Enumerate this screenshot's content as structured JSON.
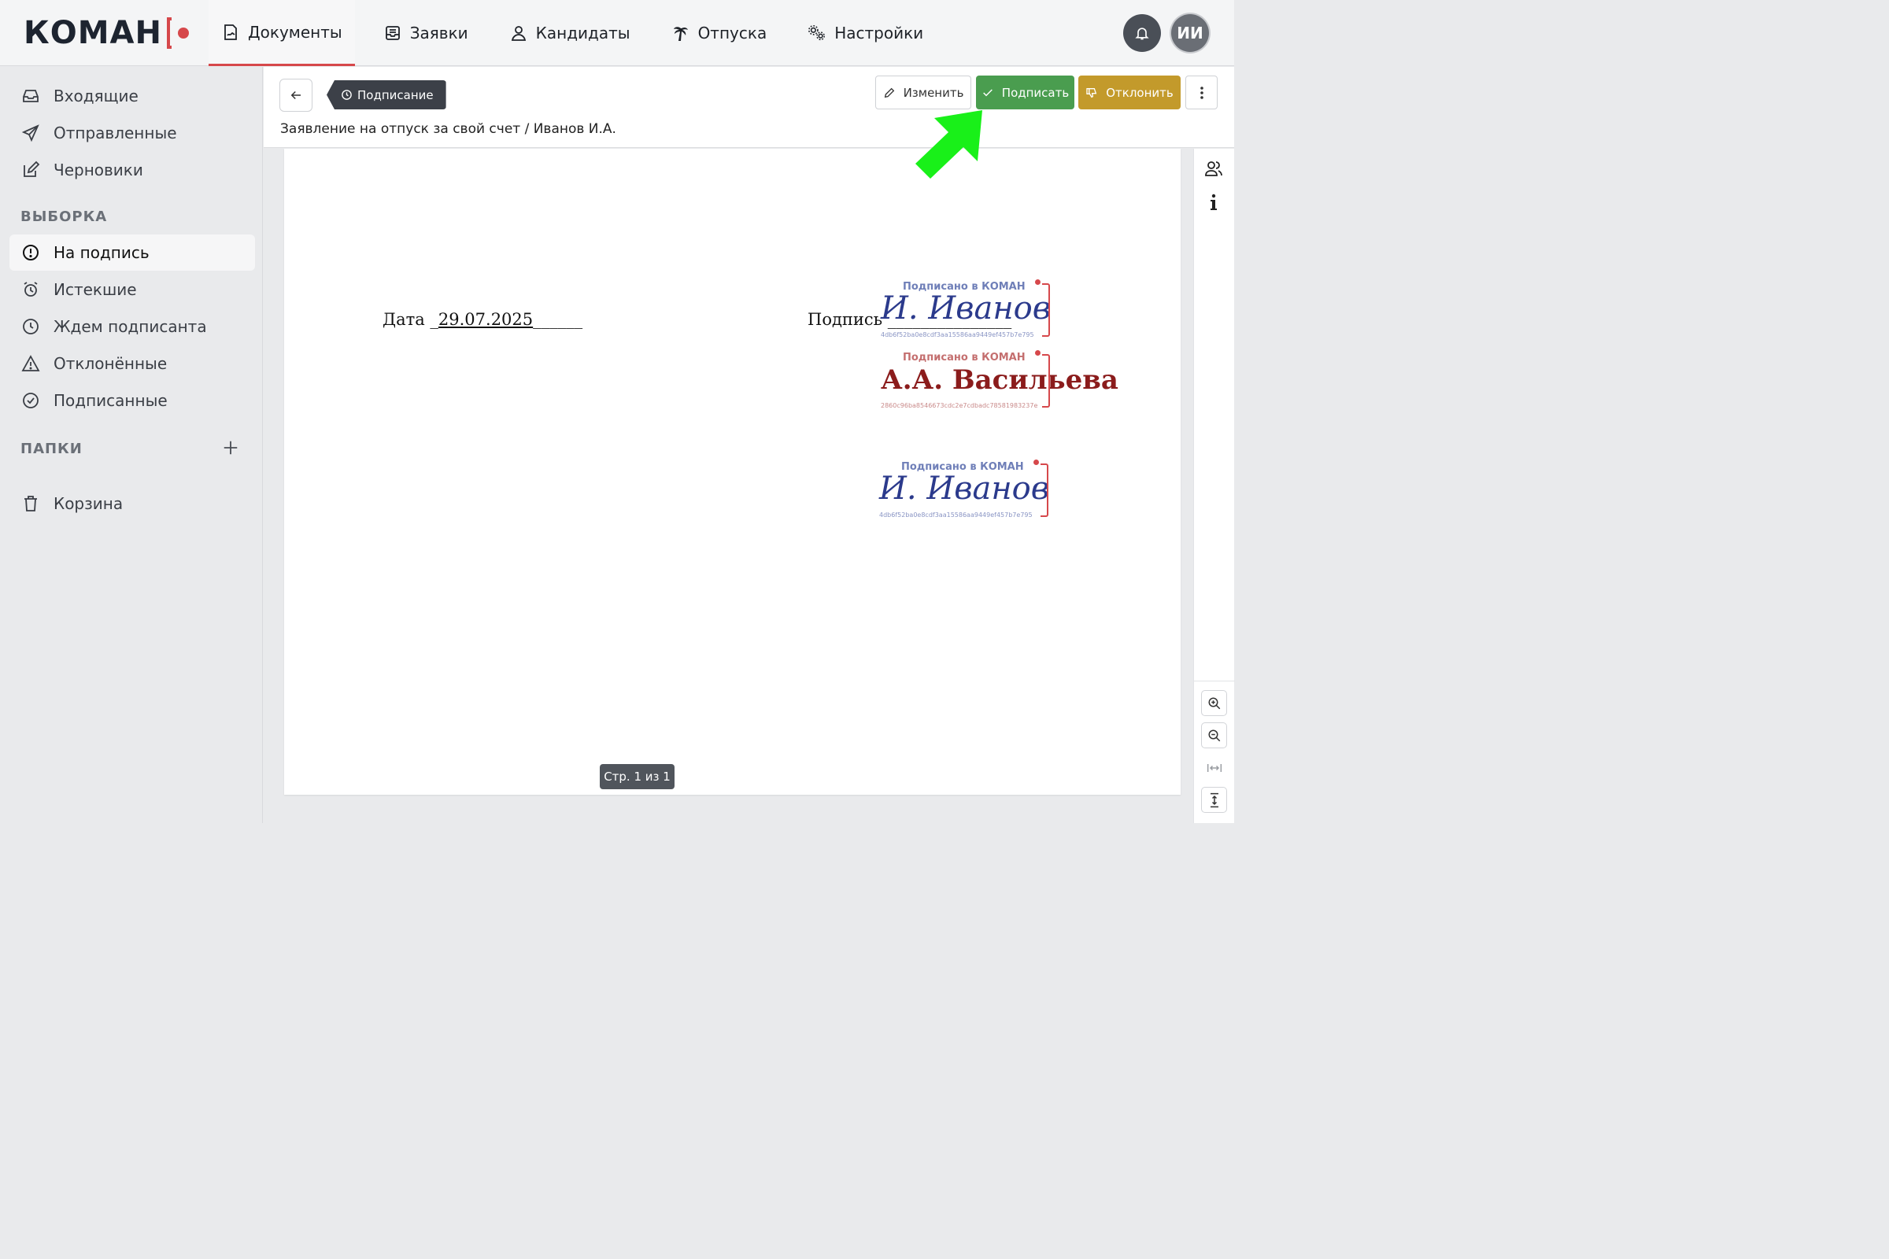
{
  "brand": {
    "name": "КОМАН",
    "accent": "#d6484b"
  },
  "nav": {
    "items": [
      {
        "label": "Документы",
        "icon": "document-signature-icon",
        "active": true
      },
      {
        "label": "Заявки",
        "icon": "inbox-tray-icon"
      },
      {
        "label": "Кандидаты",
        "icon": "candidate-icon"
      },
      {
        "label": "Отпуска",
        "icon": "palm-tree-icon"
      },
      {
        "label": "Настройки",
        "icon": "gears-icon"
      }
    ],
    "avatar_initials": "ИИ"
  },
  "sidebar": {
    "top_items": [
      {
        "label": "Входящие",
        "icon": "inbox-icon"
      },
      {
        "label": "Отправленные",
        "icon": "paper-plane-icon"
      },
      {
        "label": "Черновики",
        "icon": "edit-icon"
      }
    ],
    "section_filter": "ВЫБОРКА",
    "filter_items": [
      {
        "label": "На подпись",
        "icon": "exclamation-circle-icon",
        "active": true
      },
      {
        "label": "Истекшие",
        "icon": "alarm-clock-icon"
      },
      {
        "label": "Ждем подписанта",
        "icon": "clock-icon"
      },
      {
        "label": "Отклонённые",
        "icon": "warning-triangle-icon"
      },
      {
        "label": "Подписанные",
        "icon": "check-circle-icon"
      }
    ],
    "section_folders": "ПАПКИ",
    "trash_label": "Корзина"
  },
  "document": {
    "status": "Подписание",
    "title": "Заявление на отпуск за свой счет / Иванов И.А.",
    "actions": {
      "edit": "Изменить",
      "sign": "Подписать",
      "reject": "Отклонить"
    },
    "date_label": "Дата _",
    "date_value": "29.07.2025",
    "date_tail": "______",
    "sign_label": "Подпись _______________",
    "stamps": [
      {
        "caption": "Подписано в КОМАН",
        "signature": "И. Иванов",
        "hash": "4db6f52ba0e8cdf3aa15586aa9449ef457b7e795",
        "color": "#2b3a8c"
      },
      {
        "caption": "Подписано в КОМАН",
        "signature": "А.А. Васильева",
        "hash": "2860c96ba8546673cdc2e7cdbadc78581983237e",
        "color": "#8b1c1c"
      },
      {
        "caption": "Подписано в КОМАН",
        "signature": "И. Иванов",
        "hash": "4db6f52ba0e8cdf3aa15586aa9449ef457b7e795",
        "color": "#2b3a8c"
      }
    ],
    "page_indicator": "Стр. 1 из 1"
  },
  "colors": {
    "sign_green": "#4a9d4f",
    "reject_gold": "#c39a2b",
    "highlight_arrow": "#19f019"
  }
}
